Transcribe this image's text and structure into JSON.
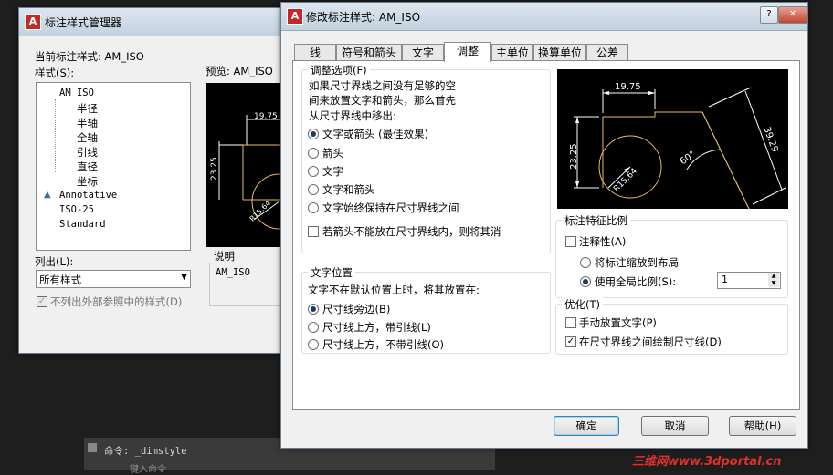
{
  "colors": {
    "accent": "#3c7fb1",
    "preview_bg": "#000000",
    "dim_line": "#ffffff",
    "geometry": "#e8b96a",
    "watermark": "#e0302a"
  },
  "back_dialog": {
    "title": "标注样式管理器",
    "current_style_label": "当前标注样式: AM_ISO",
    "styles_label": "样式(S):",
    "styles": [
      "AM_ISO",
      "半径",
      "半轴",
      "全轴",
      "引线",
      "直径",
      "坐标",
      "Annotative",
      "ISO-25",
      "Standard"
    ],
    "annotative_icon": "annotative-triangle-icon",
    "preview_label": "预览: AM_ISO",
    "list_label": "列出(L):",
    "list_value": "所有样式",
    "exclude_xref_label": "不列出外部参照中的样式(D)",
    "desc_label": "说明",
    "desc_value": "AM_ISO",
    "preview_dims": {
      "d1": "19.75",
      "d2": "23.25",
      "r": "R15.64"
    }
  },
  "front_dialog": {
    "title": "修改标注样式: AM_ISO",
    "tabs": [
      {
        "label": "线",
        "active": false
      },
      {
        "label": "符号和箭头",
        "active": false
      },
      {
        "label": "文字",
        "active": false
      },
      {
        "label": "调整",
        "active": true
      },
      {
        "label": "主单位",
        "active": false
      },
      {
        "label": "换算单位",
        "active": false
      },
      {
        "label": "公差",
        "active": false
      }
    ],
    "fit_options": {
      "title": "调整选项(F)",
      "desc_line1": "如果尺寸界线之间没有足够的空",
      "desc_line2": "间来放置文字和箭头，那么首先",
      "desc_line3": "从尺寸界线中移出:",
      "radios": [
        {
          "label": "文字或箭头 (最佳效果)",
          "checked": true
        },
        {
          "label": "箭头",
          "checked": false
        },
        {
          "label": "文字",
          "checked": false
        },
        {
          "label": "文字和箭头",
          "checked": false
        },
        {
          "label": "文字始终保持在尺寸界线之间",
          "checked": false
        }
      ],
      "suppress_arrows_label": "若箭头不能放在尺寸界线内，则将其消",
      "suppress_arrows_checked": false
    },
    "text_placement": {
      "title": "文字位置",
      "desc": "文字不在默认位置上时，将其放置在:",
      "radios": [
        {
          "label": "尺寸线旁边(B)",
          "checked": true
        },
        {
          "label": "尺寸线上方，带引线(L)",
          "checked": false
        },
        {
          "label": "尺寸线上方，不带引线(O)",
          "checked": false
        }
      ]
    },
    "scale": {
      "title": "标注特征比例",
      "annotative_label": "注释性(A)",
      "annotative_checked": false,
      "layout_label": "将标注缩放到布局",
      "global_label": "使用全局比例(S):",
      "global_value": "1"
    },
    "fine_tuning": {
      "title": "优化(T)",
      "manual_label": "手动放置文字(P)",
      "manual_checked": false,
      "draw_line_label": "在尺寸界线之间绘制尺寸线(D)",
      "draw_line_checked": true
    },
    "preview_dims": {
      "d1": "19.75",
      "d2": "23.25",
      "d3": "39.29",
      "r": "R15.64",
      "angle": "60°"
    },
    "buttons": {
      "ok": "确定",
      "cancel": "取消",
      "help": "帮助(H)"
    }
  },
  "command_line": {
    "history": "命令: _dimstyle",
    "prompt": "键入命令"
  },
  "watermark": "三维网www.3dportal.cn"
}
